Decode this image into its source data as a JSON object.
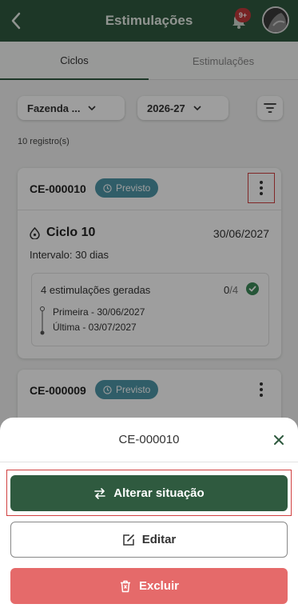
{
  "header": {
    "title": "Estimulações",
    "notification_badge": "9+"
  },
  "tabs": [
    {
      "label": "Ciclos",
      "active": true
    },
    {
      "label": "Estimulações",
      "active": false
    }
  ],
  "filters": {
    "farm": "Fazenda ...",
    "year": "2026-27"
  },
  "records_count": "10 registro(s)",
  "cards": [
    {
      "code": "CE-000010",
      "status": "Previsto",
      "cycle": "Ciclo 10",
      "date": "30/06/2027",
      "interval": "Intervalo: 30 dias",
      "generated": "4 estimulações geradas",
      "count_done": "0",
      "count_total": "/4",
      "first": "Primeira - 30/06/2027",
      "last": "Última - 03/07/2027"
    },
    {
      "code": "CE-000009",
      "status": "Previsto"
    }
  ],
  "sheet": {
    "title": "CE-000010",
    "alterar_label": "Alterar situação",
    "editar_label": "Editar",
    "excluir_label": "Excluir"
  },
  "colors": {
    "primary": "#2f5a3f",
    "status_badge": "#4e96a8",
    "danger": "#e56a6a",
    "highlight": "#d04040"
  }
}
